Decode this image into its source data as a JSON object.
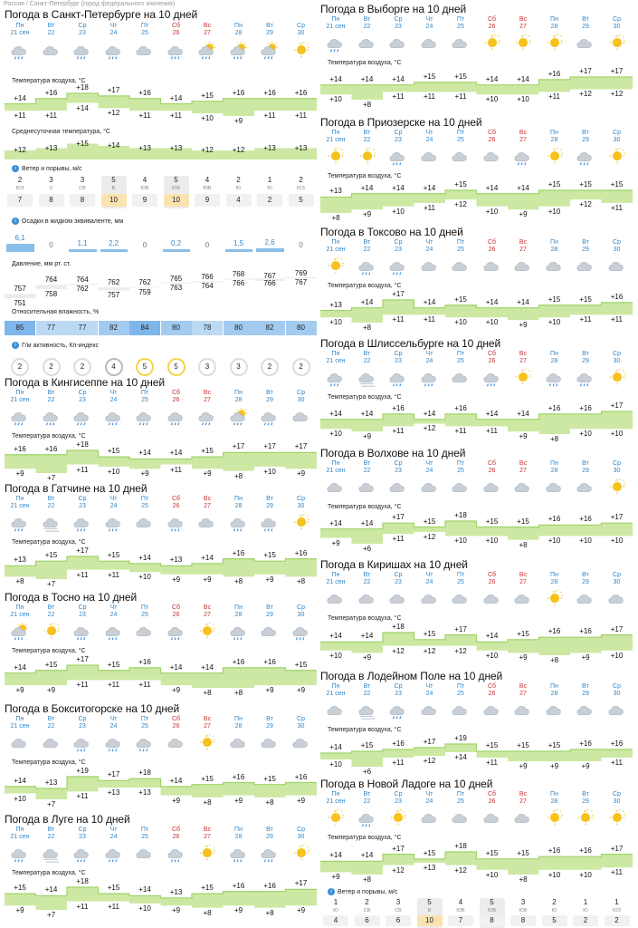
{
  "breadcrumb": "Россия / Санкт-Петербург (город федерального значения)",
  "colors": {
    "accent": "#2f86c9",
    "weekend": "#c83232",
    "temp_band": "#cde8a3",
    "humidity": "#a9cdf0"
  },
  "days": [
    {
      "name": "Пн",
      "date": "21 сен",
      "weekend": false
    },
    {
      "name": "Вт",
      "date": "22",
      "weekend": false
    },
    {
      "name": "Ср",
      "date": "23",
      "weekend": false
    },
    {
      "name": "Чт",
      "date": "24",
      "weekend": false
    },
    {
      "name": "Пт",
      "date": "25",
      "weekend": false
    },
    {
      "name": "Сб",
      "date": "26",
      "weekend": true
    },
    {
      "name": "Вс",
      "date": "27",
      "weekend": true
    },
    {
      "name": "Пн",
      "date": "28",
      "weekend": false
    },
    {
      "name": "Вт",
      "date": "29",
      "weekend": false
    },
    {
      "name": "Ср",
      "date": "30",
      "weekend": false
    }
  ],
  "labels": {
    "air_temp": "Температура воздуха, °C",
    "avg_temp": "Среднесуточная температура, °C",
    "wind": "Ветер и порывы, м/с",
    "precip": "Осадки в жидком эквиваленте, мм",
    "pressure": "Давление, мм рт. ст.",
    "humidity": "Относительная влажность, %",
    "kp": "Г/м активность, Кп-индекс"
  },
  "spb": {
    "title": "Погода в Санкт-Петербурге на 10 дней",
    "icons": [
      "rain",
      "cloud",
      "rain",
      "rain",
      "cloud",
      "rain",
      "sun-rain",
      "sun-rain",
      "sun-rain",
      "sun"
    ],
    "max": [
      "+14",
      "+16",
      "+18",
      "+17",
      "+16",
      "+14",
      "+15",
      "+16",
      "+16",
      "+16"
    ],
    "min": [
      "+11",
      "+11",
      "+14",
      "+12",
      "+11",
      "+11",
      "+10",
      "+9",
      "+11",
      "+11"
    ],
    "avg": [
      "+12",
      "+13",
      "+15",
      "+14",
      "+13",
      "+13",
      "+12",
      "+12",
      "+13",
      "+13"
    ],
    "wind": [
      {
        "speed": "2",
        "dir": "ЮЗ",
        "gust": "7"
      },
      {
        "speed": "3",
        "dir": "С",
        "gust": "8"
      },
      {
        "speed": "3",
        "dir": "СВ",
        "gust": "8"
      },
      {
        "speed": "5",
        "dir": "В",
        "gust": "10"
      },
      {
        "speed": "4",
        "dir": "ЮВ",
        "gust": "9"
      },
      {
        "speed": "5",
        "dir": "ЮВ",
        "gust": "10"
      },
      {
        "speed": "4",
        "dir": "ЮВ",
        "gust": "9"
      },
      {
        "speed": "2",
        "dir": "Ю",
        "gust": "4"
      },
      {
        "speed": "1",
        "dir": "Ю",
        "gust": "2"
      },
      {
        "speed": "2",
        "dir": "ЮЗ",
        "gust": "5"
      }
    ],
    "precip": [
      "6,1",
      "0",
      "1,1",
      "2,2",
      "0",
      "0,2",
      "0",
      "1,5",
      "2,6",
      "0"
    ],
    "precip_mm": [
      6.1,
      0,
      1.1,
      2.2,
      0,
      0.2,
      0,
      1.5,
      2.6,
      0
    ],
    "press_max": [
      "757",
      "764",
      "764",
      "762",
      "762",
      "765",
      "766",
      "768",
      "767",
      "769"
    ],
    "press_min": [
      "751",
      "758",
      "762",
      "757",
      "759",
      "763",
      "764",
      "766",
      "766",
      "767"
    ],
    "humidity": [
      "85",
      "77",
      "77",
      "82",
      "84",
      "80",
      "78",
      "80",
      "82",
      "80"
    ],
    "kp": [
      "2",
      "2",
      "2",
      "4",
      "5",
      "5",
      "3",
      "3",
      "2",
      "2"
    ]
  },
  "left_cities": [
    {
      "title": "Погода в Кингисеппе на 10 дней",
      "icons": [
        "rain",
        "rain",
        "rain",
        "rain",
        "rain",
        "rain",
        "rain",
        "sun-rain",
        "rain",
        "cloud"
      ],
      "max": [
        "+16",
        "+16",
        "+18",
        "+15",
        "+14",
        "+14",
        "+15",
        "+17",
        "+17",
        "+17"
      ],
      "min": [
        "+9",
        "+7",
        "+11",
        "+10",
        "+9",
        "+11",
        "+9",
        "+8",
        "+10",
        "+9"
      ]
    },
    {
      "title": "Погода в Гатчине на 10 дней",
      "icons": [
        "rain",
        "fog",
        "rain",
        "rain",
        "cloud",
        "rain",
        "cloud",
        "rain",
        "rain",
        "sun"
      ],
      "max": [
        "+13",
        "+15",
        "+17",
        "+15",
        "+14",
        "+13",
        "+14",
        "+16",
        "+15",
        "+16"
      ],
      "min": [
        "+8",
        "+7",
        "+11",
        "+11",
        "+10",
        "+9",
        "+9",
        "+8",
        "+9",
        "+8"
      ]
    },
    {
      "title": "Погода в Тосно на 10 дней",
      "icons": [
        "sun-rain",
        "sun",
        "rain",
        "rain",
        "cloud",
        "rain",
        "sun",
        "rain",
        "cloud",
        "rain"
      ],
      "max": [
        "+14",
        "+15",
        "+17",
        "+15",
        "+16",
        "+14",
        "+14",
        "+16",
        "+16",
        "+15"
      ],
      "min": [
        "+9",
        "+9",
        "+11",
        "+11",
        "+11",
        "+9",
        "+8",
        "+8",
        "+9",
        "+9"
      ]
    },
    {
      "title": "Погода в Бокситогорске на 10 дней",
      "icons": [
        "cloud",
        "cloud",
        "rain",
        "rain",
        "rain",
        "cloud",
        "sun",
        "cloud",
        "cloud",
        "cloud"
      ],
      "max": [
        "+14",
        "+13",
        "+19",
        "+17",
        "+18",
        "+14",
        "+15",
        "+16",
        "+15",
        "+16"
      ],
      "min": [
        "+10",
        "+7",
        "+11",
        "+13",
        "+13",
        "+9",
        "+8",
        "+9",
        "+8",
        "+9"
      ]
    },
    {
      "title": "Погода в Луге на 10 дней",
      "icons": [
        "rain",
        "fog",
        "rain",
        "rain",
        "cloud",
        "rain",
        "sun",
        "rain",
        "rain",
        "sun"
      ],
      "max": [
        "+15",
        "+14",
        "+18",
        "+15",
        "+14",
        "+13",
        "+15",
        "+16",
        "+16",
        "+17"
      ],
      "min": [
        "+9",
        "+7",
        "+11",
        "+11",
        "+10",
        "+9",
        "+8",
        "+9",
        "+8",
        "+9"
      ]
    }
  ],
  "right_cities": [
    {
      "title": "Погода в Выборге на 10 дней",
      "icons": [
        "rain",
        "cloud",
        "cloud",
        "cloud",
        "cloud",
        "sun",
        "sun",
        "sun",
        "cloud",
        "sun"
      ],
      "max": [
        "+14",
        "+14",
        "+14",
        "+15",
        "+15",
        "+14",
        "+14",
        "+16",
        "+17",
        "+17"
      ],
      "min": [
        "+10",
        "+8",
        "+11",
        "+11",
        "+11",
        "+10",
        "+10",
        "+11",
        "+12",
        "+12"
      ]
    },
    {
      "title": "Погода в Приозерске на 10 дней",
      "icons": [
        "sun",
        "sun",
        "rain",
        "cloud",
        "cloud",
        "cloud",
        "rain",
        "sun",
        "rain",
        "sun"
      ],
      "max": [
        "+13",
        "+14",
        "+14",
        "+14",
        "+15",
        "+14",
        "+14",
        "+15",
        "+15",
        "+15"
      ],
      "min": [
        "+8",
        "+9",
        "+10",
        "+11",
        "+12",
        "+10",
        "+9",
        "+10",
        "+12",
        "+11"
      ]
    },
    {
      "title": "Погода в Токсово на 10 дней",
      "icons": [
        "sun",
        "rain",
        "rain",
        "cloud",
        "cloud",
        "cloud",
        "cloud",
        "cloud",
        "cloud",
        "cloud"
      ],
      "max": [
        "+13",
        "+14",
        "+17",
        "+14",
        "+15",
        "+14",
        "+14",
        "+15",
        "+15",
        "+16"
      ],
      "min": [
        "+10",
        "+8",
        "+11",
        "+11",
        "+10",
        "+10",
        "+9",
        "+10",
        "+11",
        "+11"
      ]
    },
    {
      "title": "Погода в Шлиссельбурге на 10 дней",
      "icons": [
        "rain",
        "fog",
        "rain",
        "rain",
        "cloud",
        "rain",
        "sun",
        "rain",
        "rain",
        "sun"
      ],
      "max": [
        "+14",
        "+14",
        "+16",
        "+14",
        "+16",
        "+14",
        "+14",
        "+16",
        "+16",
        "+17"
      ],
      "min": [
        "+10",
        "+9",
        "+11",
        "+12",
        "+11",
        "+11",
        "+9",
        "+8",
        "+10",
        "+10"
      ]
    },
    {
      "title": "Погода в Волхове на 10 дней",
      "icons": [
        "cloud",
        "cloud",
        "cloud",
        "cloud",
        "cloud",
        "cloud",
        "cloud",
        "cloud",
        "cloud",
        "sun"
      ],
      "max": [
        "+14",
        "+14",
        "+17",
        "+15",
        "+18",
        "+15",
        "+15",
        "+16",
        "+16",
        "+17"
      ],
      "min": [
        "+9",
        "+6",
        "+11",
        "+12",
        "+10",
        "+10",
        "+8",
        "+10",
        "+10",
        "+10"
      ]
    },
    {
      "title": "Погода в Киришах на 10 дней",
      "icons": [
        "cloud",
        "cloud",
        "cloud",
        "cloud",
        "cloud",
        "cloud",
        "cloud",
        "sun",
        "cloud",
        "cloud"
      ],
      "max": [
        "+14",
        "+14",
        "+18",
        "+15",
        "+17",
        "+14",
        "+15",
        "+16",
        "+16",
        "+17"
      ],
      "min": [
        "+10",
        "+9",
        "+12",
        "+12",
        "+12",
        "+10",
        "+9",
        "+8",
        "+9",
        "+10"
      ]
    },
    {
      "title": "Погода в Лодейном Поле на 10 дней",
      "icons": [
        "cloud",
        "fog",
        "rain",
        "cloud",
        "cloud",
        "cloud",
        "cloud",
        "cloud",
        "cloud",
        "cloud"
      ],
      "max": [
        "+14",
        "+15",
        "+16",
        "+17",
        "+19",
        "+15",
        "+15",
        "+15",
        "+16",
        "+16"
      ],
      "min": [
        "+10",
        "+6",
        "+11",
        "+12",
        "+14",
        "+11",
        "+9",
        "+9",
        "+9",
        "+11"
      ]
    },
    {
      "title": "Погода в Новой Ладоге на 10 дней",
      "icons": [
        "sun",
        "rain",
        "sun",
        "cloud",
        "cloud",
        "cloud",
        "cloud",
        "sun",
        "sun",
        "sun"
      ],
      "max": [
        "+14",
        "+14",
        "+17",
        "+15",
        "+18",
        "+15",
        "+15",
        "+16",
        "+16",
        "+17"
      ],
      "min": [
        "+9",
        "+8",
        "+12",
        "+13",
        "+12",
        "+10",
        "+8",
        "+10",
        "+10",
        "+11"
      ],
      "wind": [
        {
          "speed": "1",
          "dir": "Ю",
          "gust": "4"
        },
        {
          "speed": "2",
          "dir": "СВ",
          "gust": "6"
        },
        {
          "speed": "3",
          "dir": "СВ",
          "gust": "6"
        },
        {
          "speed": "5",
          "dir": "В",
          "gust": "10"
        },
        {
          "speed": "4",
          "dir": "ЮВ",
          "gust": "7"
        },
        {
          "speed": "5",
          "dir": "ЮВ",
          "gust": "8"
        },
        {
          "speed": "3",
          "dir": "ЮВ",
          "gust": "8"
        },
        {
          "speed": "2",
          "dir": "Ю",
          "gust": "5"
        },
        {
          "speed": "1",
          "dir": "Ю",
          "gust": "2"
        },
        {
          "speed": "1",
          "dir": "ЮЗ",
          "gust": "2"
        }
      ]
    }
  ]
}
